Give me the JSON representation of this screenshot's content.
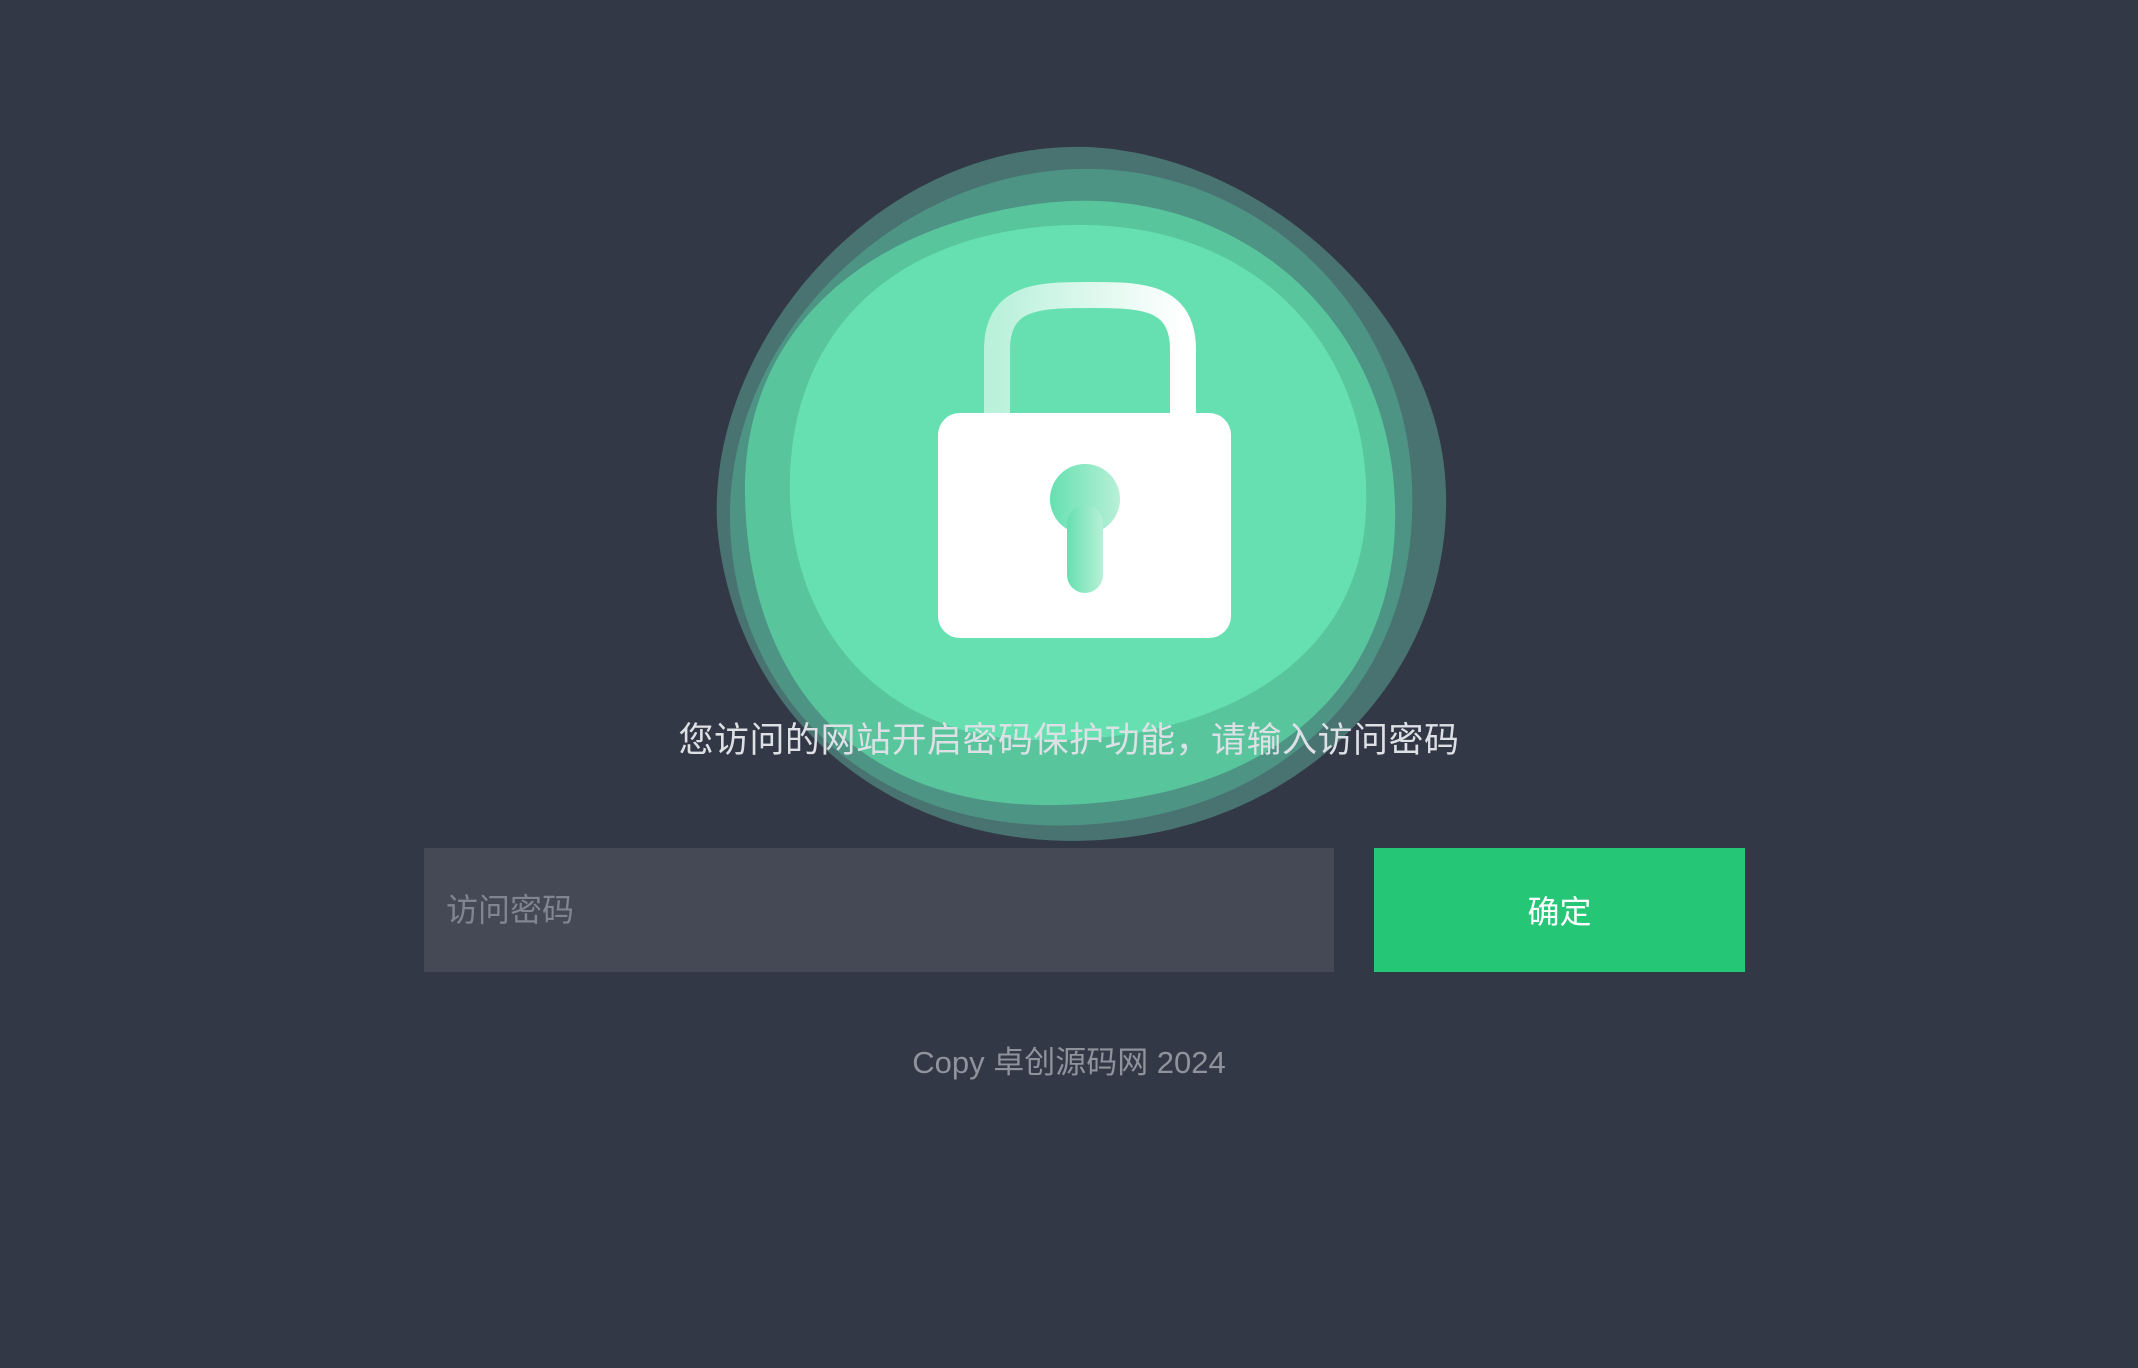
{
  "lock": {
    "icon": "lock-icon",
    "glow_color_light": "#66e0b0",
    "glow_color_dark": "#4d9a88"
  },
  "message": "您访问的网站开启密码保护功能，请输入访问密码",
  "form": {
    "password_placeholder": "访问密码",
    "password_value": "",
    "confirm_label": "确定"
  },
  "footer": {
    "text": "Copy 卓创源码网 2024"
  },
  "colors": {
    "background": "#333846",
    "input_background": "#444955",
    "button": "#26c677"
  }
}
